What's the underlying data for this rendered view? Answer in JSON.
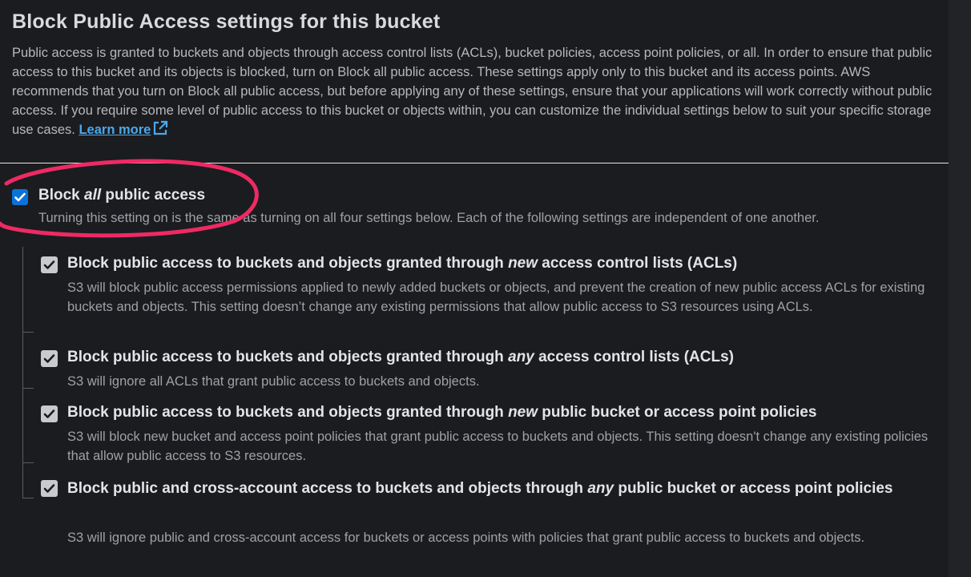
{
  "section": {
    "title": "Block Public Access settings for this bucket",
    "description": "Public access is granted to buckets and objects through access control lists (ACLs), bucket policies, access point policies, or all. In order to ensure that public access to this bucket and its objects is blocked, turn on Block all public access. These settings apply only to this bucket and its access points. AWS recommends that you turn on Block all public access, but before applying any of these settings, ensure that your applications will work correctly without public access. If you require some level of public access to this bucket or objects within, you can customize the individual settings below to suit your specific storage use cases.",
    "learn_more": "Learn more"
  },
  "block_all": {
    "label_prefix": "Block ",
    "label_emphasis": "all",
    "label_suffix": " public access",
    "checked": true,
    "description": "Turning this setting on is the same as turning on all four settings below. Each of the following settings are independent of one another."
  },
  "options": [
    {
      "label_prefix": "Block public access to buckets and objects granted through ",
      "label_emphasis": "new",
      "label_suffix": " access control lists (ACLs)",
      "checked": true,
      "disabled": true,
      "description": "S3 will block public access permissions applied to newly added buckets or objects, and prevent the creation of new public access ACLs for existing buckets and objects. This setting doesn’t change any existing permissions that allow public access to S3 resources using ACLs."
    },
    {
      "label_prefix": "Block public access to buckets and objects granted through ",
      "label_emphasis": "any",
      "label_suffix": " access control lists (ACLs)",
      "checked": true,
      "disabled": true,
      "description": "S3 will ignore all ACLs that grant public access to buckets and objects."
    },
    {
      "label_prefix": "Block public access to buckets and objects granted through ",
      "label_emphasis": "new",
      "label_suffix": " public bucket or access point policies",
      "checked": true,
      "disabled": true,
      "description": "S3 will block new bucket and access point policies that grant public access to buckets and objects. This setting doesn't change any existing policies that allow public access to S3 resources."
    },
    {
      "label_prefix": "Block public and cross-account access to buckets and objects through ",
      "label_emphasis": "any",
      "label_suffix": " public bucket or access point policies",
      "checked": true,
      "disabled": true,
      "description": "S3 will ignore public and cross-account access for buckets or access points with policies that grant public access to buckets and objects."
    }
  ],
  "colors": {
    "background": "#1b1c1f",
    "link": "#4aa8ec",
    "checkbox_checked": "#0a72d8",
    "annotation_highlight": "#ee2a64"
  },
  "icons": {
    "learn_more": "external-link-icon",
    "checkbox": "checkmark-icon"
  }
}
